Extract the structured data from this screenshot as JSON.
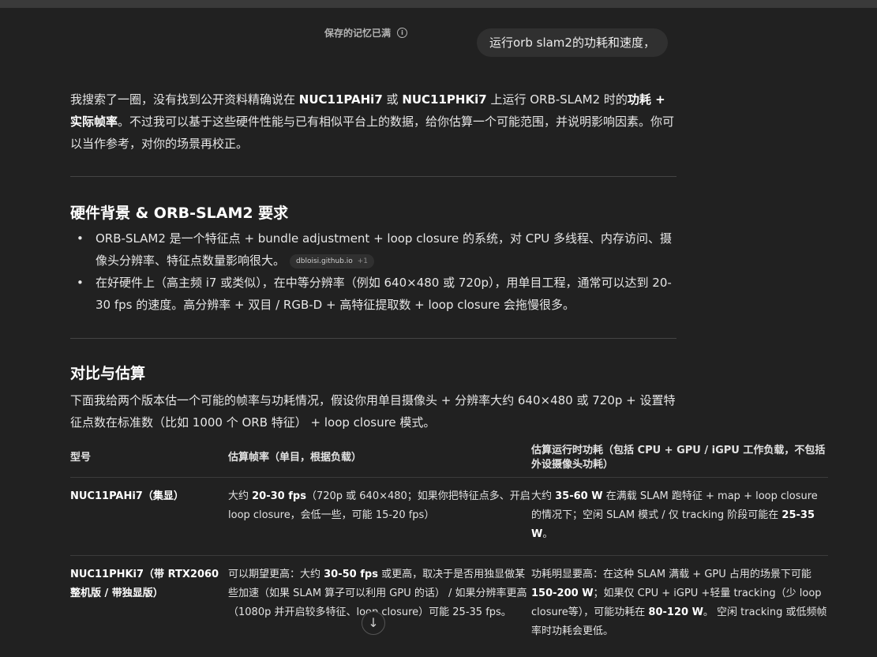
{
  "header": {
    "memory_note": "保存的记忆已满",
    "user_message": "运行orb slam2的功耗和速度，"
  },
  "intro": {
    "t1": "我搜索了一圈，没有找到公开资料精确说在 ",
    "m1": "NUC11PAHi7",
    "t2": " 或 ",
    "m2": "NUC11PHKi7",
    "t3": " 上运行 ORB-SLAM2 时的",
    "m3": "功耗 + 实际帧率",
    "t4": "。不过我可以基于这些硬件性能与已有相似平台上的数据，给你估算一个可能范围，并说明影响因素。你可以当作参考，对你的场景再校正。"
  },
  "section1": {
    "title": "硬件背景 & ORB-SLAM2 要求",
    "bullet1": "ORB-SLAM2 是一个特征点 + bundle adjustment + loop closure 的系统，对 CPU 多线程、内存访问、摄像头分辨率、特征点数量影响很大。",
    "source_site": "dbloisi.github.io",
    "source_more": "+1",
    "bullet2": "在好硬件上（高主频 i7 或类似），在中等分辨率（例如 640×480 或 720p），用单目工程，通常可以达到 20-30 fps 的速度。高分辨率 + 双目 / RGB-D + 高特征提取数 + loop closure 会拖慢很多。"
  },
  "section2": {
    "title": "对比与估算",
    "intro": "下面我给两个版本估一个可能的帧率与功耗情况，假设你用单目摄像头 + 分辨率大约 640×480 或 720p + 设置特征点数在标准数（比如 1000 个 ORB 特征） + loop closure 模式。"
  },
  "table": {
    "headers": [
      "型号",
      "估算帧率（单目，根据负载）",
      "估算运行时功耗（包括 CPU + GPU / iGPU 工作负载，不包括外设摄像头功耗）"
    ],
    "row1": {
      "model": "NUC11PAHi7（集显）",
      "fps_a": "大约 ",
      "fps_b": "20-30 fps",
      "fps_c": "（720p 或 640×480；如果你把特征点多、开启 loop closure，会低一些，可能 15-20 fps）",
      "pow_a": "大约 ",
      "pow_b": "35-60 W",
      "pow_c": " 在满载 SLAM 跑特征 + map + loop closure 的情况下；空闲 SLAM 模式 / 仅 tracking 阶段可能在 ",
      "pow_d": "25-35 W",
      "pow_e": "。"
    },
    "row2": {
      "model": "NUC11PHKi7（带 RTX2060 整机版 / 带独显版）",
      "fps_a": "可以期望更高：大约 ",
      "fps_b": "30-50 fps",
      "fps_c": " 或更高，取决于是否用独显做某些加速（如果 SLAM 算子可以利用 GPU 的话） / 如果分辨率更高（1080p 并开启较多特征、loop closure）可能 25-35 fps。",
      "pow_a": "功耗明显要高：在这种 SLAM 满载 + GPU 占用的场景下可能 ",
      "pow_b": "150-200 W",
      "pow_c": "；如果仅 CPU + iGPU +轻量 tracking（少 loop closure等），可能功耗在 ",
      "pow_d": "80-120 W",
      "pow_e": "。 空闲 tracking 或低频帧率时功耗会更低。"
    }
  },
  "icons": {
    "info": "info-icon",
    "scroll": "arrow-down-icon"
  }
}
